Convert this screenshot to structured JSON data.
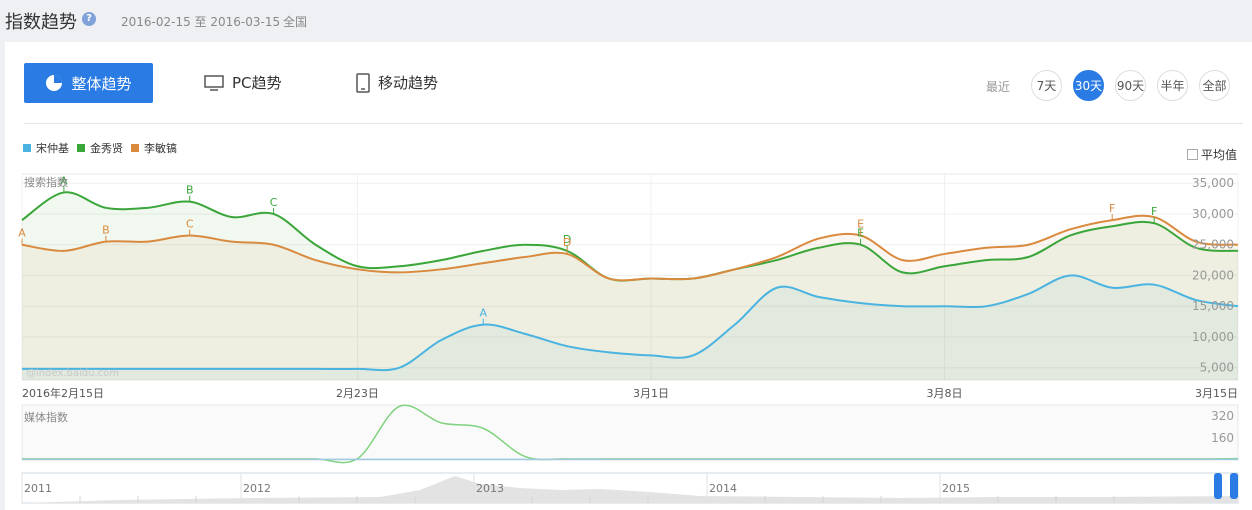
{
  "header": {
    "title": "指数趋势",
    "help_icon": "?",
    "date_range": "2016-02-15 至 2016-03-15",
    "region": "全国"
  },
  "tabs": [
    {
      "label": "整体趋势",
      "icon": "pie-chart-icon",
      "active": true
    },
    {
      "label": "PC趋势",
      "icon": "monitor-icon",
      "active": false
    },
    {
      "label": "移动趋势",
      "icon": "mobile-icon",
      "active": false
    }
  ],
  "range_selector": {
    "label": "最近",
    "options": [
      "7天",
      "30天",
      "90天",
      "半年",
      "全部"
    ],
    "selected": "30天"
  },
  "legend": [
    {
      "name": "宋仲基",
      "color": "#4ab3e0"
    },
    {
      "name": "金秀贤",
      "color": "#3aa639"
    },
    {
      "name": "李敏镐",
      "color": "#d98a3e"
    }
  ],
  "average_toggle": {
    "label": "平均值",
    "checked": false
  },
  "chart_data": [
    {
      "type": "line",
      "title": "搜索指数",
      "watermark": "@index.baidu.com",
      "x_labels": [
        "2016年2月15日",
        "2月23日",
        "3月1日",
        "3月8日",
        "3月15日"
      ],
      "y_ticks": [
        "35,000",
        "30,000",
        "25,000",
        "20,000",
        "15,000",
        "10,000",
        "5,000"
      ],
      "ylim": [
        3000,
        36500
      ],
      "x": [
        "2016-02-15",
        "2016-02-16",
        "2016-02-17",
        "2016-02-18",
        "2016-02-19",
        "2016-02-20",
        "2016-02-21",
        "2016-02-22",
        "2016-02-23",
        "2016-02-24",
        "2016-02-25",
        "2016-02-26",
        "2016-02-27",
        "2016-02-28",
        "2016-02-29",
        "2016-03-01",
        "2016-03-02",
        "2016-03-03",
        "2016-03-04",
        "2016-03-05",
        "2016-03-06",
        "2016-03-07",
        "2016-03-08",
        "2016-03-09",
        "2016-03-10",
        "2016-03-11",
        "2016-03-12",
        "2016-03-13",
        "2016-03-14",
        "2016-03-15"
      ],
      "series": [
        {
          "name": "宋仲基",
          "color": "#4ab3e0",
          "values": [
            4800,
            4800,
            4800,
            4800,
            4800,
            4800,
            4800,
            4800,
            4800,
            5000,
            9500,
            12000,
            10500,
            8500,
            7500,
            7000,
            7000,
            12000,
            18000,
            16500,
            15500,
            15000,
            15000,
            15000,
            17000,
            20000,
            18000,
            18500,
            16000,
            15000
          ]
        },
        {
          "name": "金秀贤",
          "color": "#3aa639",
          "values": [
            29000,
            33500,
            31000,
            31000,
            32000,
            29500,
            30000,
            25000,
            21500,
            21500,
            22500,
            24000,
            25000,
            24000,
            19500,
            19500,
            19500,
            21000,
            22500,
            24500,
            25000,
            20500,
            21500,
            22500,
            23000,
            26500,
            28000,
            28500,
            24500,
            24000
          ]
        },
        {
          "name": "李敏镐",
          "color": "#d98a3e",
          "values": [
            25000,
            24000,
            25500,
            25500,
            26500,
            25500,
            25000,
            22500,
            21000,
            20500,
            21000,
            22000,
            23000,
            23500,
            19500,
            19500,
            19500,
            21000,
            23000,
            26000,
            26500,
            22500,
            23500,
            24500,
            25000,
            27500,
            29000,
            29500,
            25500,
            25000
          ]
        }
      ],
      "annotations": [
        {
          "label": "A",
          "series": "金秀贤",
          "x": "2016-02-16"
        },
        {
          "label": "B",
          "series": "金秀贤",
          "x": "2016-02-19"
        },
        {
          "label": "C",
          "series": "金秀贤",
          "x": "2016-02-21"
        },
        {
          "label": "D",
          "series": "金秀贤",
          "x": "2016-02-28"
        },
        {
          "label": "E",
          "series": "金秀贤",
          "x": "2016-03-06"
        },
        {
          "label": "F",
          "series": "金秀贤",
          "x": "2016-03-13"
        },
        {
          "label": "A",
          "series": "李敏镐",
          "x": "2016-02-15"
        },
        {
          "label": "B",
          "series": "李敏镐",
          "x": "2016-02-17"
        },
        {
          "label": "C",
          "series": "李敏镐",
          "x": "2016-02-19"
        },
        {
          "label": "D",
          "series": "李敏镐",
          "x": "2016-02-28"
        },
        {
          "label": "E",
          "series": "李敏镐",
          "x": "2016-03-06"
        },
        {
          "label": "F",
          "series": "李敏镐",
          "x": "2016-03-12"
        },
        {
          "label": "A",
          "series": "宋仲基",
          "x": "2016-02-26"
        }
      ]
    },
    {
      "type": "line",
      "title": "媒体指数",
      "y_ticks": [
        "320",
        "160"
      ],
      "ylim": [
        0,
        400
      ],
      "x": [
        "2016-02-15",
        "2016-02-16",
        "2016-02-17",
        "2016-02-18",
        "2016-02-19",
        "2016-02-20",
        "2016-02-21",
        "2016-02-22",
        "2016-02-23",
        "2016-02-24",
        "2016-02-25",
        "2016-02-26",
        "2016-02-27",
        "2016-02-28",
        "2016-02-29",
        "2016-03-01",
        "2016-03-02",
        "2016-03-03",
        "2016-03-04",
        "2016-03-05",
        "2016-03-06",
        "2016-03-07",
        "2016-03-08",
        "2016-03-09",
        "2016-03-10",
        "2016-03-11",
        "2016-03-12",
        "2016-03-13",
        "2016-03-14",
        "2016-03-15"
      ],
      "series": [
        {
          "name": "金秀贤",
          "color": "#7fd37f",
          "values": [
            8,
            8,
            8,
            8,
            8,
            8,
            8,
            8,
            10,
            390,
            270,
            230,
            25,
            8,
            8,
            8,
            8,
            8,
            8,
            8,
            8,
            8,
            8,
            8,
            8,
            8,
            8,
            8,
            8,
            10
          ]
        },
        {
          "name": "宋仲基",
          "color": "#9fc9e0",
          "values": [
            5,
            5,
            5,
            5,
            5,
            5,
            5,
            5,
            5,
            5,
            5,
            5,
            5,
            5,
            5,
            5,
            5,
            5,
            5,
            5,
            5,
            5,
            5,
            5,
            5,
            5,
            5,
            5,
            5,
            5
          ]
        }
      ]
    }
  ],
  "timeline": {
    "years": [
      "2011",
      "2012",
      "2013",
      "2014",
      "2015"
    ]
  }
}
